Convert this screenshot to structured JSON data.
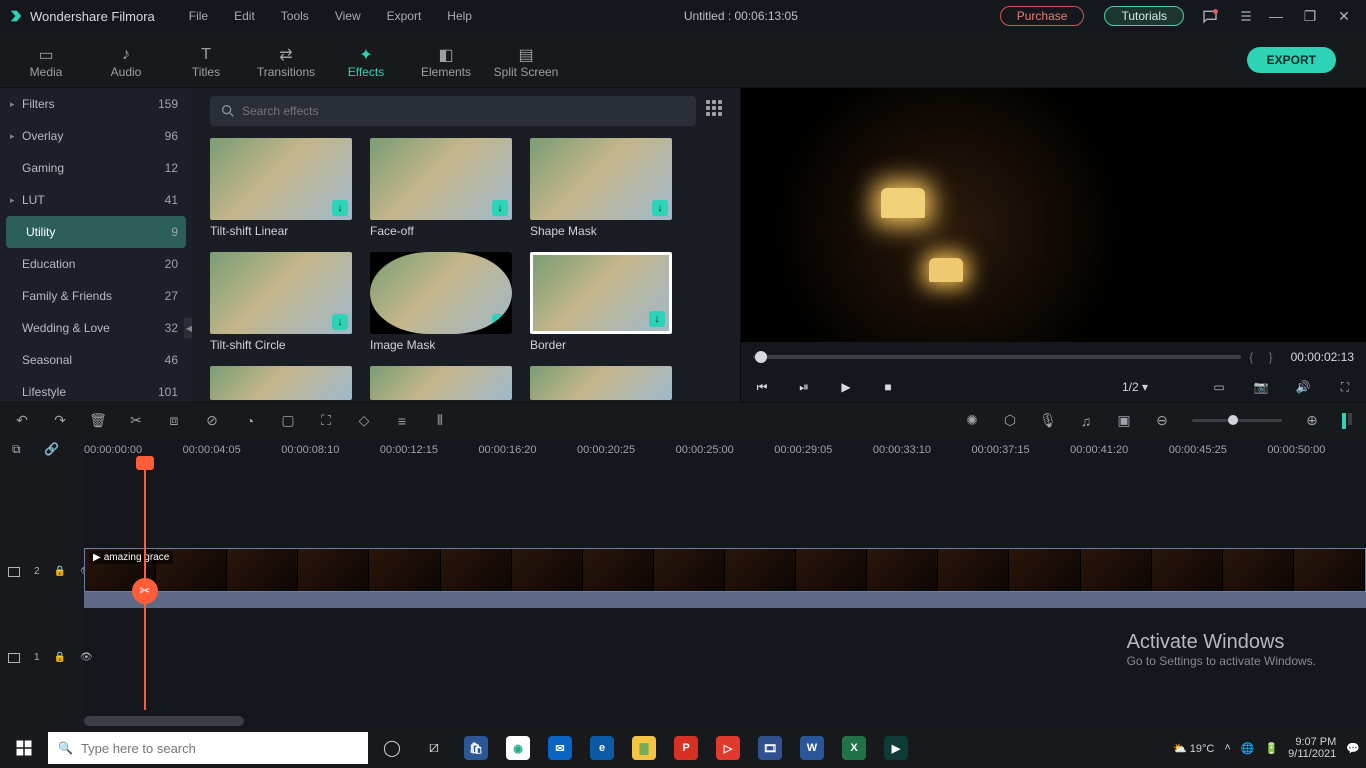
{
  "app_name": "Wondershare Filmora",
  "menus": [
    "File",
    "Edit",
    "Tools",
    "View",
    "Export",
    "Help"
  ],
  "document_title": "Untitled : 00:06:13:05",
  "pill_purchase": "Purchase",
  "pill_tutorials": "Tutorials",
  "mode_tabs": {
    "media": "Media",
    "audio": "Audio",
    "titles": "Titles",
    "transitions": "Transitions",
    "effects": "Effects",
    "elements": "Elements",
    "split": "Split Screen"
  },
  "export_label": "EXPORT",
  "categories": [
    {
      "name": "Filters",
      "count": 159,
      "hasChildren": true
    },
    {
      "name": "Overlay",
      "count": 96,
      "hasChildren": true
    },
    {
      "name": "Gaming",
      "count": 12,
      "hasChildren": false
    },
    {
      "name": "LUT",
      "count": 41,
      "hasChildren": true
    },
    {
      "name": "Utility",
      "count": 9,
      "hasChildren": false,
      "selected": true
    },
    {
      "name": "Education",
      "count": 20,
      "hasChildren": false
    },
    {
      "name": "Family & Friends",
      "count": 27,
      "hasChildren": false
    },
    {
      "name": "Wedding & Love",
      "count": 32,
      "hasChildren": false
    },
    {
      "name": "Seasonal",
      "count": 46,
      "hasChildren": false
    },
    {
      "name": "Lifestyle",
      "count": 101,
      "hasChildren": false
    }
  ],
  "search_placeholder": "Search effects",
  "effects": [
    {
      "label": "Tilt-shift Linear",
      "dl": true
    },
    {
      "label": "Face-off",
      "dl": true
    },
    {
      "label": "Shape Mask",
      "dl": true
    },
    {
      "label": "Tilt-shift Circle",
      "dl": true
    },
    {
      "label": "Image Mask",
      "dl": true,
      "style": "ellipse"
    },
    {
      "label": "Border",
      "dl": true,
      "style": "border"
    }
  ],
  "preview_timecode": "00:00:02:13",
  "preview_ratio": "1/2",
  "timeline_ticks": [
    "00:00:00:00",
    "00:00:04:05",
    "00:00:08:10",
    "00:00:12:15",
    "00:00:16:20",
    "00:00:20:25",
    "00:00:25:00",
    "00:00:29:05",
    "00:00:33:10",
    "00:00:37:15",
    "00:00:41:20",
    "00:00:45:25",
    "00:00:50:00"
  ],
  "clip_name": "amazing grace",
  "track_labels": {
    "t2": "2",
    "t1": "1"
  },
  "watermark": {
    "title": "Activate Windows",
    "sub": "Go to Settings to activate Windows."
  },
  "taskbar": {
    "search_placeholder": "Type here to search",
    "weather": "19°C",
    "time": "9:07 PM",
    "date": "9/11/2021"
  }
}
